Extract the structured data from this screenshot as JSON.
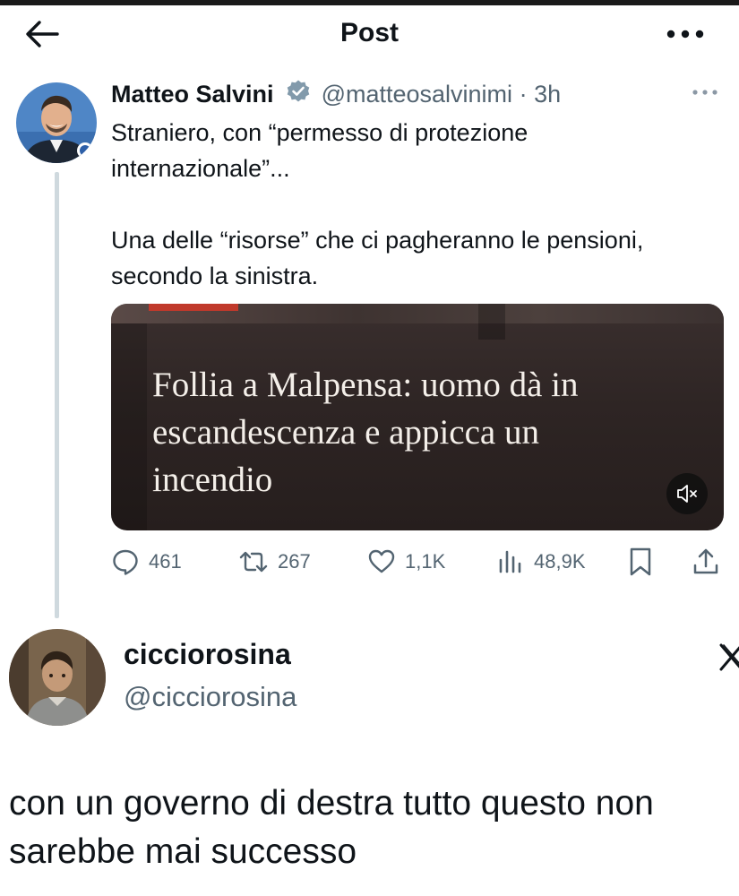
{
  "header": {
    "title": "Post",
    "back_icon": "arrow-left-icon",
    "more_icon": "more-horizontal-icon"
  },
  "tweet": {
    "author_name": "Matteo Salvini",
    "verified_icon": "verified-badge-icon",
    "handle": "@matteosalvinimi",
    "separator": "·",
    "time": "3h",
    "text_lines": [
      "Straniero, con “permesso di protezione",
      "internazionale”...",
      "Una delle “risorse” che ci pagheranno le pensioni,",
      "secondo la sinistra."
    ],
    "media": {
      "headline_lines": [
        "Follia a Malpensa: uomo dà in",
        "escandescenza e appicca un",
        "incendio"
      ],
      "mute_icon": "speaker-muted-icon"
    },
    "stats": {
      "replies": "461",
      "reposts": "267",
      "likes": "1,1K",
      "views": "48,9K"
    }
  },
  "quote_author": {
    "name": "cicciorosina",
    "handle": "@cicciorosina",
    "logo_icon": "x-logo-icon"
  },
  "reply_text_lines": [
    "con un governo di destra tutto questo non",
    "sarebbe mai successo"
  ],
  "colors": {
    "text": "#0f1419",
    "secondary": "#536471",
    "verified": "#829aab",
    "thread_line": "#cfd9de"
  }
}
